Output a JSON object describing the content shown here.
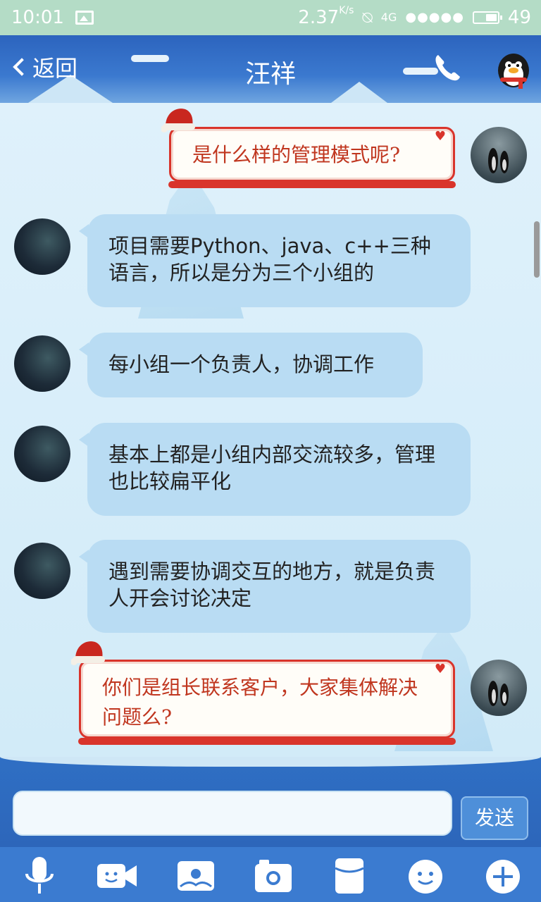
{
  "status_bar": {
    "time": "10:01",
    "net_speed": "2.37",
    "net_speed_unit": "K/s",
    "network_type": "4G",
    "signal": "●●●●●",
    "battery_level": "49",
    "battery_fraction": 0.49
  },
  "header": {
    "back_label": "返回",
    "contact_name": "汪祥"
  },
  "messages": [
    {
      "sender": "me",
      "text": "是什么样的管理模式呢?"
    },
    {
      "sender": "other",
      "text": "项目需要Python、java、c++三种语言，所以是分为三个小组的"
    },
    {
      "sender": "other",
      "text": "每小组一个负责人，协调工作"
    },
    {
      "sender": "other",
      "text": "基本上都是小组内部交流较多，管理也比较扁平化"
    },
    {
      "sender": "other",
      "text": "遇到需要协调交互的地方，就是负责人开会讨论决定"
    },
    {
      "sender": "me",
      "text": "你们是组长联系客户，大家集体解决问题么?"
    }
  ],
  "input": {
    "value": "",
    "send_label": "发送"
  },
  "toolbar": {
    "icons": [
      "microphone-icon",
      "video-icon",
      "photo-icon",
      "camera-icon",
      "red-packet-icon",
      "emoji-icon",
      "plus-icon"
    ]
  },
  "colors": {
    "header_blue": "#3b79cf",
    "bubble_blue": "#b9dcf3",
    "bubble_red_border": "#d9342b",
    "bubble_red_text": "#c0361f",
    "status_bar": "#b4dcc6"
  }
}
